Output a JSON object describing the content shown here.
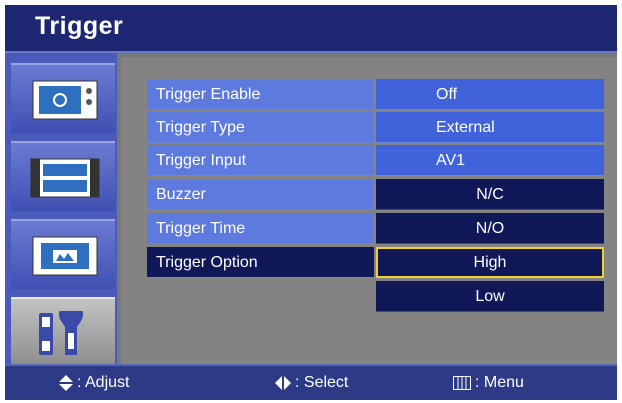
{
  "title": "Trigger",
  "sidebar": {
    "tabs": [
      {
        "icon": "display-settings-icon",
        "selected": false
      },
      {
        "icon": "film-strip-icon",
        "selected": false
      },
      {
        "icon": "picture-icon",
        "selected": false
      },
      {
        "icon": "tools-icon",
        "selected": true
      }
    ]
  },
  "menu": {
    "rows": [
      {
        "label": "Trigger Enable",
        "value": "Off"
      },
      {
        "label": "Trigger Type",
        "value": "External"
      },
      {
        "label": "Trigger Input",
        "value": "AV1"
      },
      {
        "label": "Buzzer",
        "value": "N/C"
      },
      {
        "label": "Trigger Time",
        "value": "N/O"
      },
      {
        "label": "Trigger Option",
        "value": "High",
        "selected": true
      }
    ],
    "extra_option": "Low"
  },
  "status": {
    "adjust": ": Adjust",
    "select": ": Select",
    "menu": ": Menu"
  },
  "colors": {
    "highlight": "#f0d02a",
    "label_blue": "#5d7bdf",
    "value_blue": "#4062db",
    "dark_navy": "#101858"
  }
}
